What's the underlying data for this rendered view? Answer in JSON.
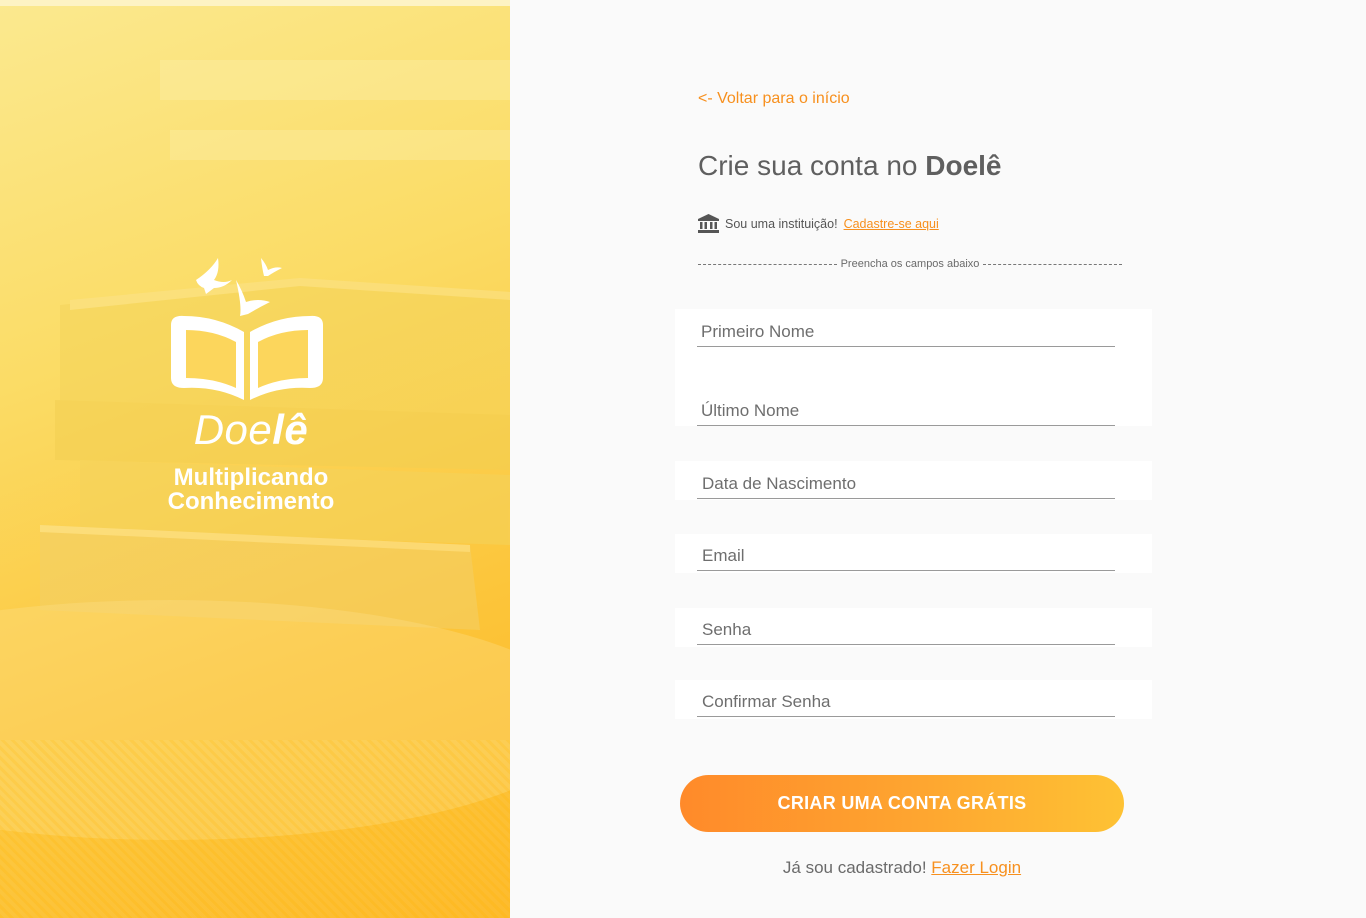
{
  "hero": {
    "brand_name_light": "Doe",
    "brand_name_bold": "lê",
    "tagline_line1": "Multiplicando",
    "tagline_line2": "Conhecimento"
  },
  "nav": {
    "back_label": "<- Voltar para o início"
  },
  "header": {
    "title_prefix": "Crie sua conta no ",
    "title_brand": "Doelê"
  },
  "institution": {
    "text": "Sou uma instituição!",
    "link_label": "Cadastre-se aqui",
    "icon": "bank-icon"
  },
  "divider": {
    "label": "Preencha os campos abaixo"
  },
  "form": {
    "fields": [
      {
        "name": "first-name",
        "placeholder": "Primeiro Nome",
        "value": ""
      },
      {
        "name": "last-name",
        "placeholder": "Último Nome",
        "value": ""
      },
      {
        "name": "birth-date",
        "placeholder": "Data de Nascimento",
        "value": ""
      },
      {
        "name": "email",
        "placeholder": "Email",
        "value": ""
      },
      {
        "name": "password",
        "placeholder": "Senha",
        "value": ""
      },
      {
        "name": "confirm-password",
        "placeholder": "Confirmar Senha",
        "value": ""
      }
    ],
    "submit_label": "CRIAR UMA CONTA GRÁTIS"
  },
  "login": {
    "text": "Já sou cadastrado!",
    "link_label": "Fazer Login"
  },
  "colors": {
    "accent": "#f7901e",
    "button_start": "#ff8a2a",
    "button_end": "#fec234",
    "hero_top": "#fbe98f",
    "hero_bottom": "#fdb421"
  }
}
